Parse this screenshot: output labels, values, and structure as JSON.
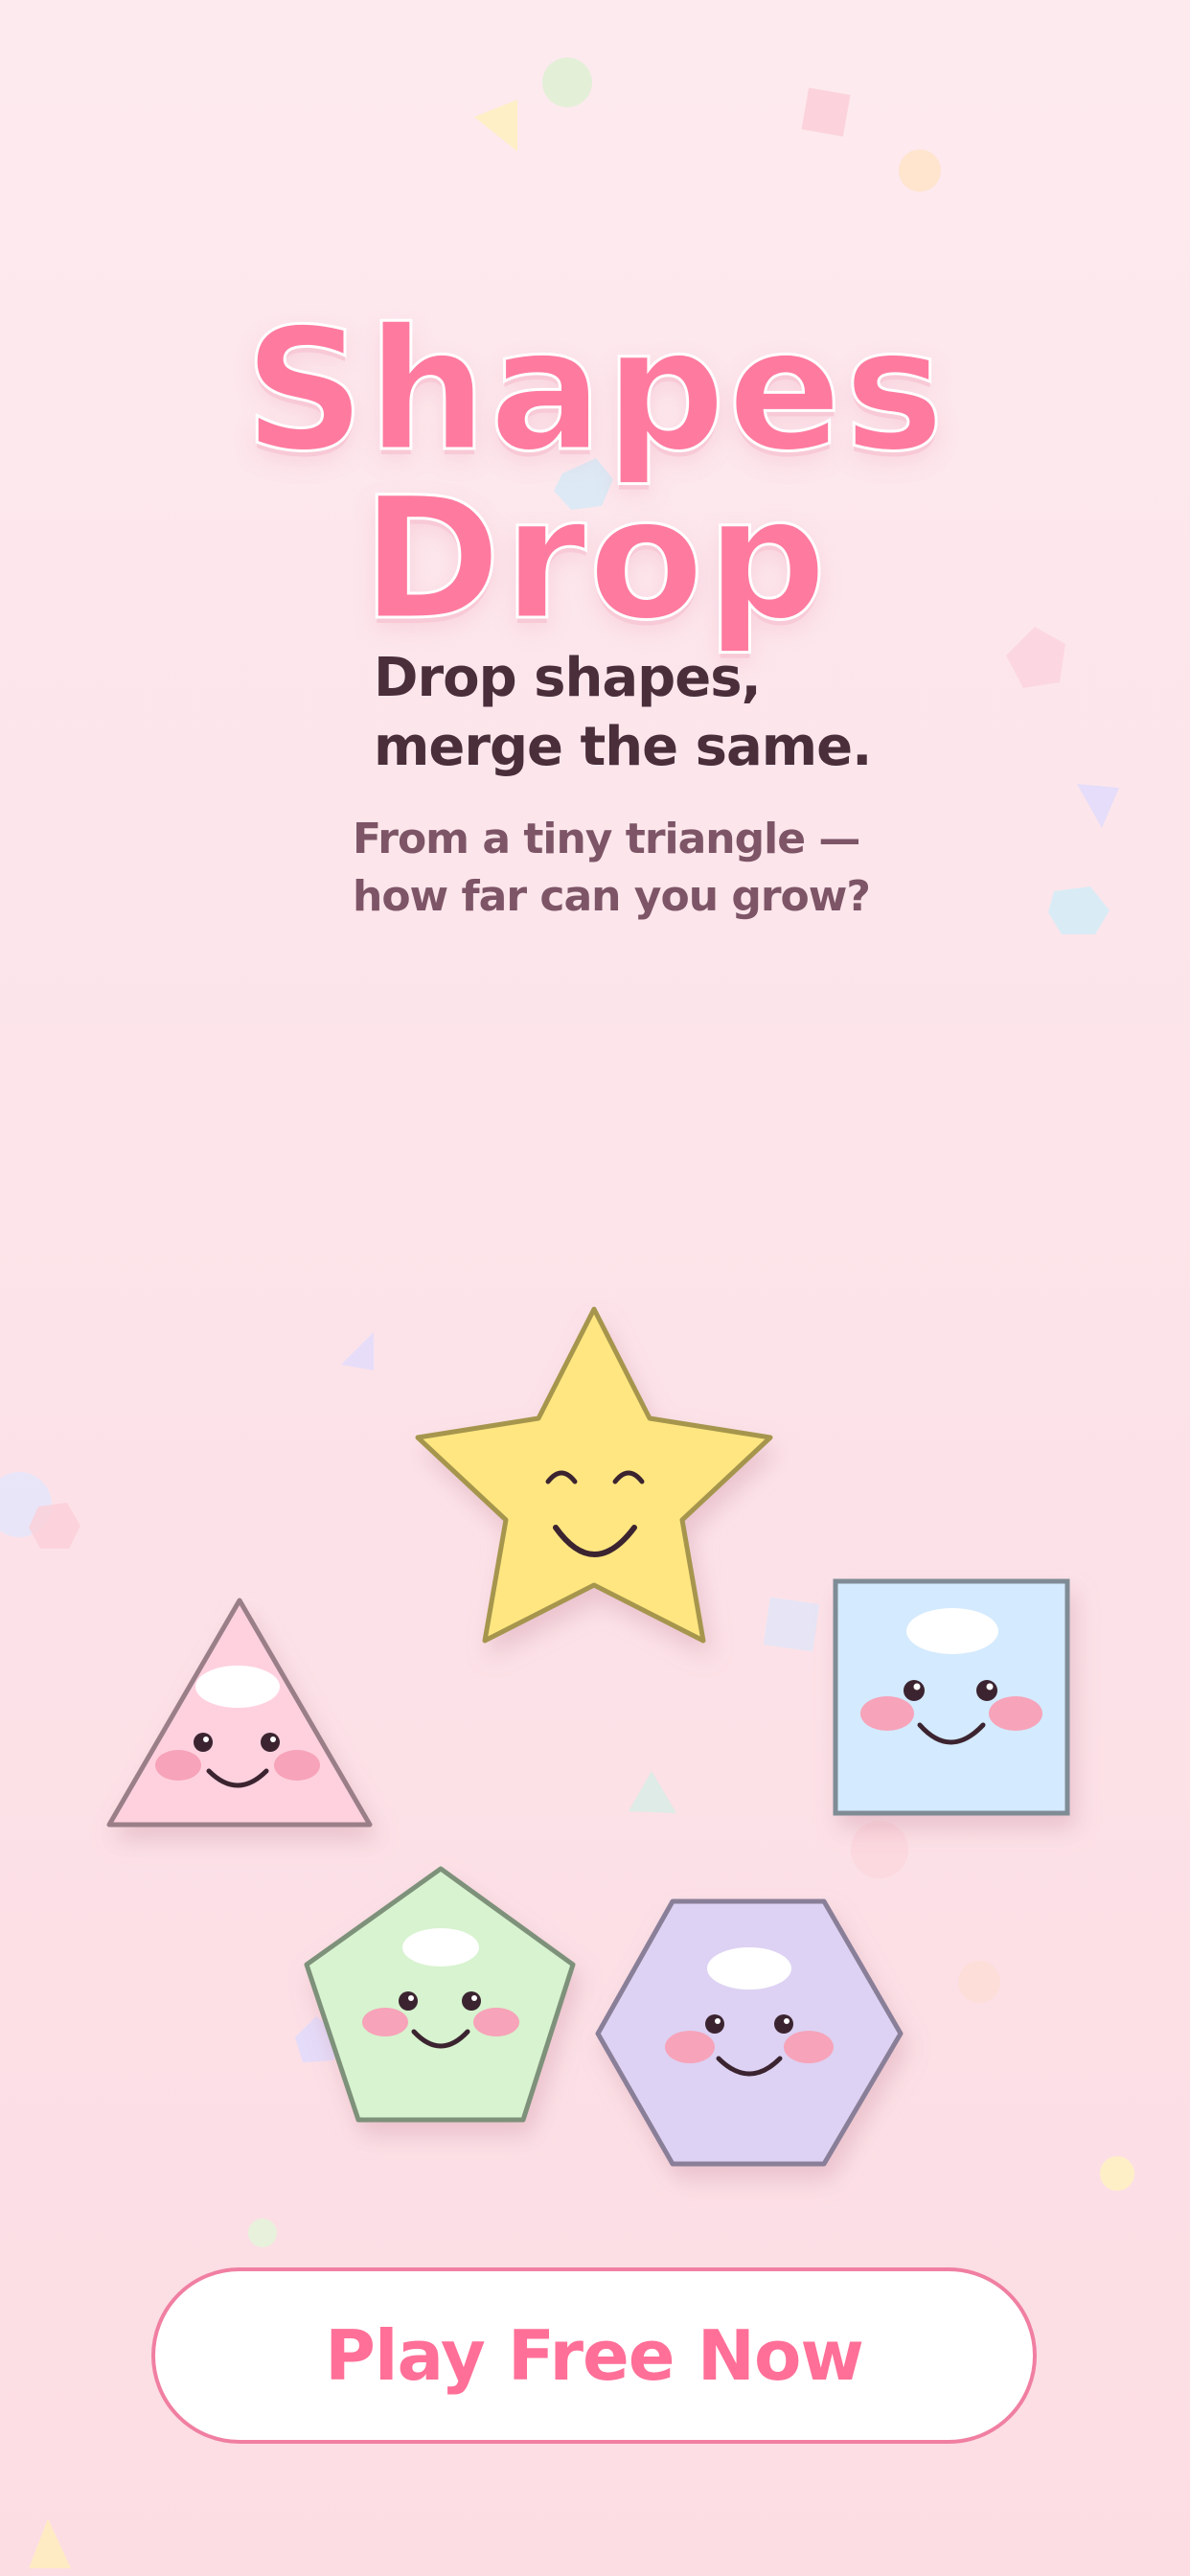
{
  "title": "Shapes Drop",
  "tagline": [
    "Drop shapes,",
    "merge the same."
  ],
  "subline": [
    "From a tiny triangle —",
    "how far can you grow?"
  ],
  "play_button": "Play Free Now",
  "characters": [
    {
      "shape": "star",
      "color": "#ffe680"
    },
    {
      "shape": "triangle",
      "color": "#ffd1df"
    },
    {
      "shape": "square",
      "color": "#d4eafe"
    },
    {
      "shape": "pentagon",
      "color": "#d7f3cf"
    },
    {
      "shape": "hexagon",
      "color": "#ddd2f3"
    }
  ],
  "colors": {
    "background": "#fde8ee",
    "title": "#ff7a9f",
    "button_text": "#ff6f97",
    "button_border": "#f07fa2",
    "text_dark": "#4a2e3a",
    "text_muted": "#7d5566"
  }
}
